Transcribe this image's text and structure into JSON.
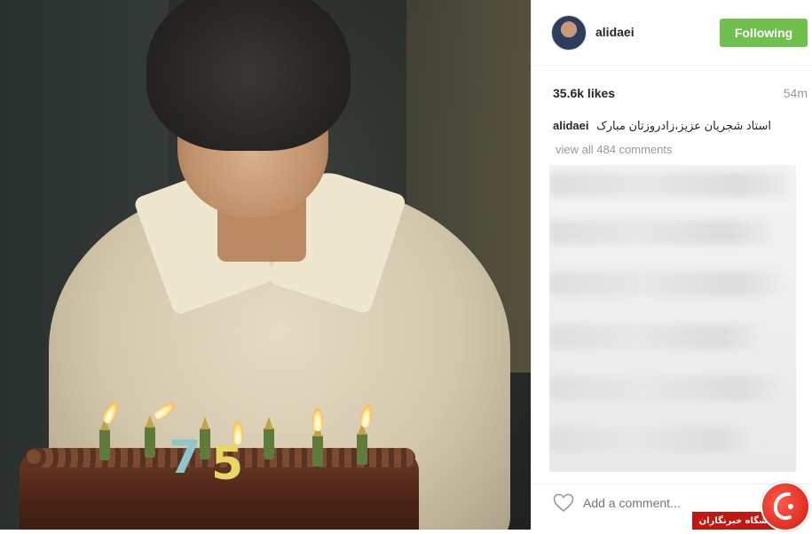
{
  "post": {
    "username": "alidaei",
    "follow_label": "Following",
    "likes": "35.6k likes",
    "time": "54m",
    "caption_user": "alidaei",
    "caption_text": "استاد شجریان عزیز،زادروزتان مبارک",
    "view_all": "view all 484 comments",
    "comment_placeholder": "Add a comment..."
  },
  "photo": {
    "candle_numbers": [
      "7",
      "5"
    ]
  },
  "watermark": {
    "text": "باشگاه خبرنگاران"
  },
  "colors": {
    "follow_button": "#70c050",
    "watermark": "#c01810"
  },
  "icons": [
    "heart-icon",
    "avatar",
    "watermark-logo-icon"
  ]
}
